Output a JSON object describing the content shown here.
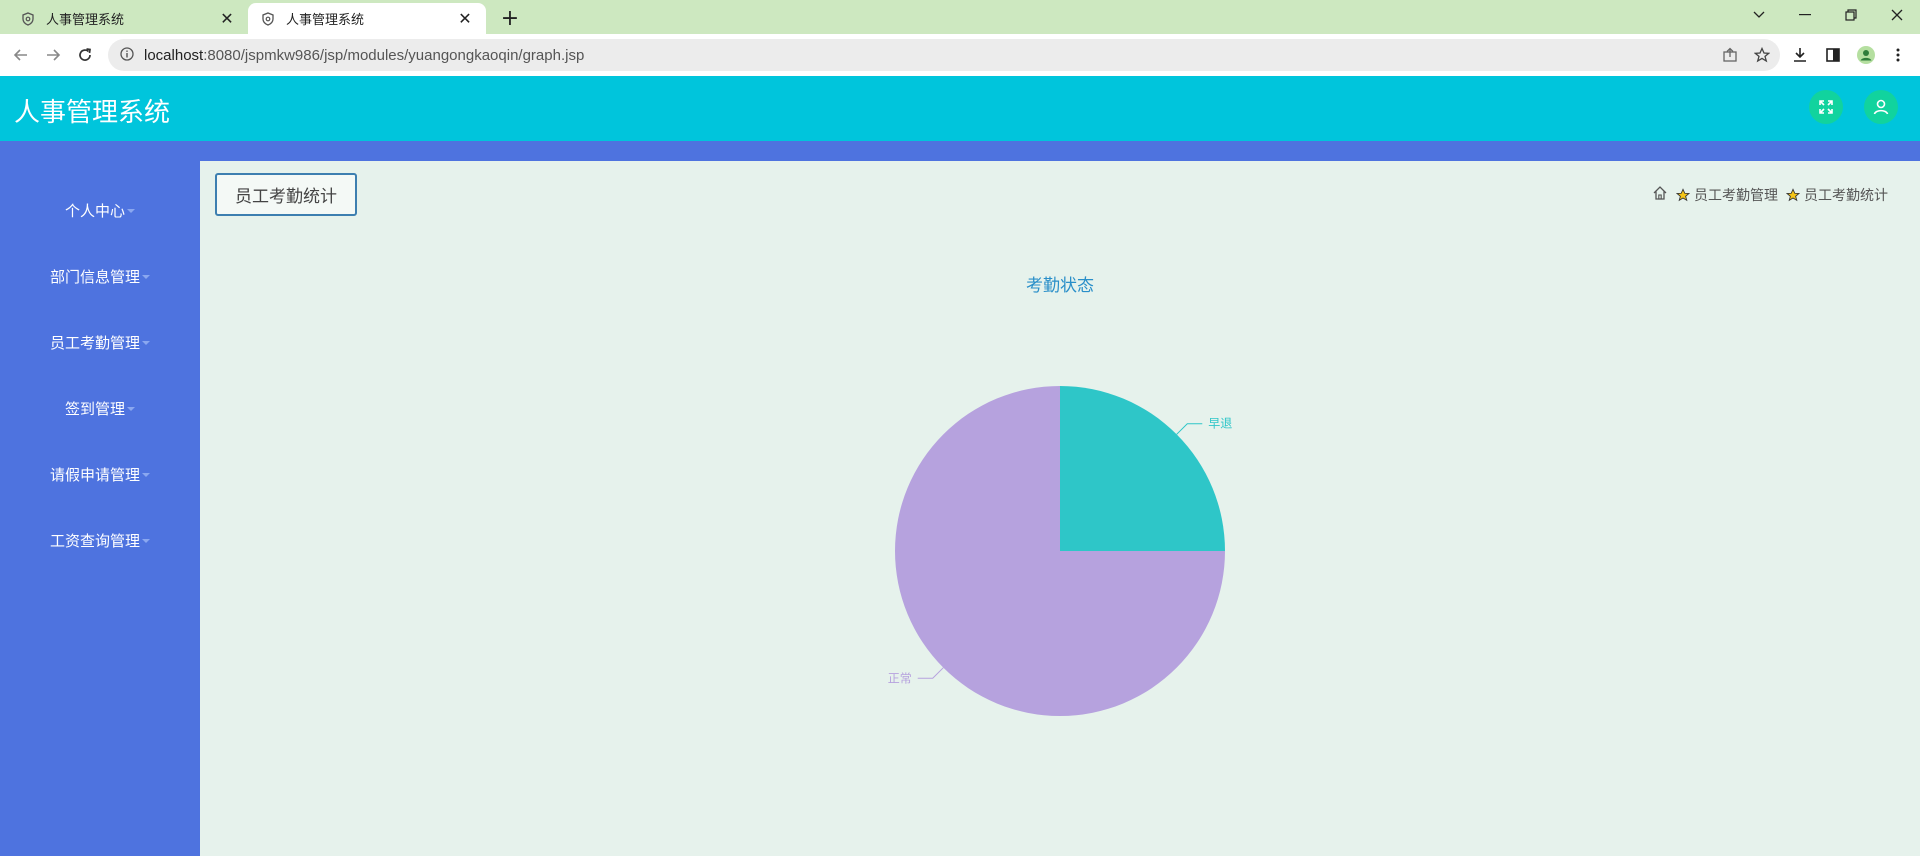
{
  "browser": {
    "tabs": [
      {
        "title": "人事管理系统",
        "active": false
      },
      {
        "title": "人事管理系统",
        "active": true
      }
    ],
    "url_host": "localhost",
    "url_path": ":8080/jspmkw986/jsp/modules/yuangongkaoqin/graph.jsp"
  },
  "header": {
    "title": "人事管理系统"
  },
  "sidebar": {
    "items": [
      {
        "label": "个人中心"
      },
      {
        "label": "部门信息管理"
      },
      {
        "label": "员工考勤管理"
      },
      {
        "label": "签到管理"
      },
      {
        "label": "请假申请管理"
      },
      {
        "label": "工资查询管理"
      }
    ]
  },
  "main": {
    "page_button": "员工考勤统计",
    "breadcrumb": [
      "员工考勤管理",
      "员工考勤统计"
    ]
  },
  "colors": {
    "header": "#00c5dc",
    "sidebar": "#4e73df",
    "background": "#e6f2ec",
    "slice_early": "#2ec6c8",
    "slice_normal": "#b6a2de"
  },
  "chart_data": {
    "type": "pie",
    "title": "考勤状态",
    "categories": [
      "早退",
      "正常"
    ],
    "values": [
      1,
      3
    ],
    "colors": [
      "#2ec6c8",
      "#b6a2de"
    ]
  }
}
